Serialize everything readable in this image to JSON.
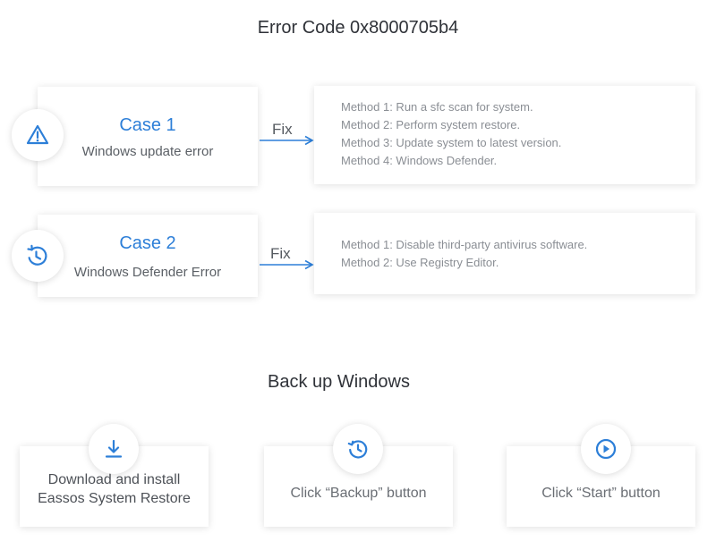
{
  "header": {
    "title": "Error Code 0x8000705b4"
  },
  "cases": [
    {
      "title": "Case 1",
      "subtitle": "Windows update error",
      "icon": "warning-icon",
      "fix_label": "Fix",
      "methods": [
        "Method 1: Run a sfc scan for system.",
        "Method 2: Perform system restore.",
        "Method 3: Update system to latest version.",
        "Method 4: Windows Defender."
      ]
    },
    {
      "title": "Case 2",
      "subtitle": "Windows Defender Error",
      "icon": "sync-clock-icon",
      "fix_label": "Fix",
      "methods": [
        "Method 1: Disable third-party antivirus software.",
        "Method 2: Use Registry Editor."
      ]
    }
  ],
  "backup": {
    "title": "Back up Windows",
    "steps": [
      {
        "icon": "download-icon",
        "line1": "Download and install",
        "line2": "Eassos System Restore"
      },
      {
        "icon": "history-icon",
        "label": "Click “Backup” button"
      },
      {
        "icon": "play-icon",
        "label": "Click “Start” button"
      }
    ]
  },
  "colors": {
    "accent": "#2d7fd8",
    "text": "#555a60",
    "muted": "#8a8e94"
  }
}
